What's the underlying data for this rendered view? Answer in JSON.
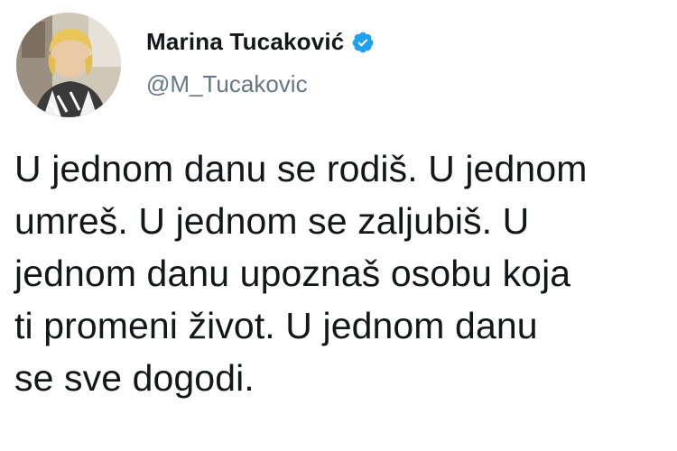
{
  "author": {
    "display_name": "Marina Tucaković",
    "handle": "@M_Tucakovic",
    "verified": true,
    "avatar_icon": "profile-photo",
    "verified_icon": "verified-badge-icon"
  },
  "tweet": {
    "text": "U jednom danu se rodiš. U jednom\numreš. U jednom se zaljubiš. U\njednom danu upoznaš osobu koja\nti promeni život. U jednom danu\nse sve dogodi."
  },
  "colors": {
    "verified_badge": "#1da1f2",
    "handle": "#657786",
    "text": "#14171a"
  }
}
